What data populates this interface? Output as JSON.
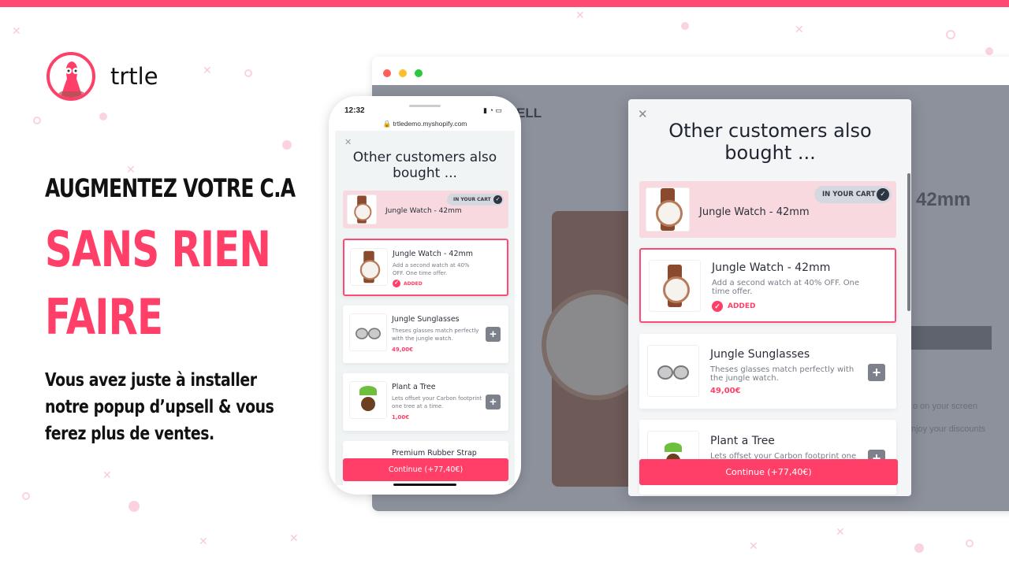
{
  "brand": {
    "name": "trtle",
    "accent": "#ff3f68"
  },
  "hero": {
    "line1": "AUGMENTEZ VOTRE C.A",
    "line2": "SANS RIEN",
    "line3": "FAIRE",
    "paragraph": "Vous avez juste à installer notre popup d’upsell & vous ferez plus de ventes."
  },
  "desktop": {
    "background_texts": {
      "logo_fragment": "ELL",
      "size": "42mm",
      "line1": "o on your screen",
      "line2": "njoy your discounts"
    },
    "popup": {
      "close_icon": "close-icon",
      "title": "Other customers also bought ...",
      "cart_item": {
        "name": "Jungle Watch - 42mm",
        "badge": "IN YOUR CART"
      },
      "items": [
        {
          "name": "Jungle Watch - 42mm",
          "desc": "Add a second watch at 40% OFF. One time offer.",
          "status": "ADDED"
        },
        {
          "name": "Jungle Sunglasses",
          "desc": "Theses glasses match perfectly with the jungle watch.",
          "price": "49,00€"
        },
        {
          "name": "Plant a Tree",
          "desc": "Lets offset your Carbon footprint one tree at a time."
        }
      ],
      "continue": "Continue (+77,40€)"
    }
  },
  "phone": {
    "time": "12:32",
    "url": "trtledemo.myshopify.com",
    "popup": {
      "title": "Other customers also bought ...",
      "cart_item": {
        "name": "Jungle Watch - 42mm",
        "badge": "IN YOUR CART"
      },
      "items": [
        {
          "name": "Jungle Watch - 42mm",
          "desc": "Add a second watch at 40% OFF. One time offer.",
          "status": "ADDED"
        },
        {
          "name": "Jungle Sunglasses",
          "desc": "Theses glasses match perfectly with the jungle watch.",
          "price": "49,00€"
        },
        {
          "name": "Plant a Tree",
          "desc": "Lets offset your Carbon footprint one tree at a time.",
          "price": "1,00€"
        },
        {
          "name": "Premium Rubber Strap"
        }
      ],
      "continue": "Continue (+77,40€)"
    }
  }
}
